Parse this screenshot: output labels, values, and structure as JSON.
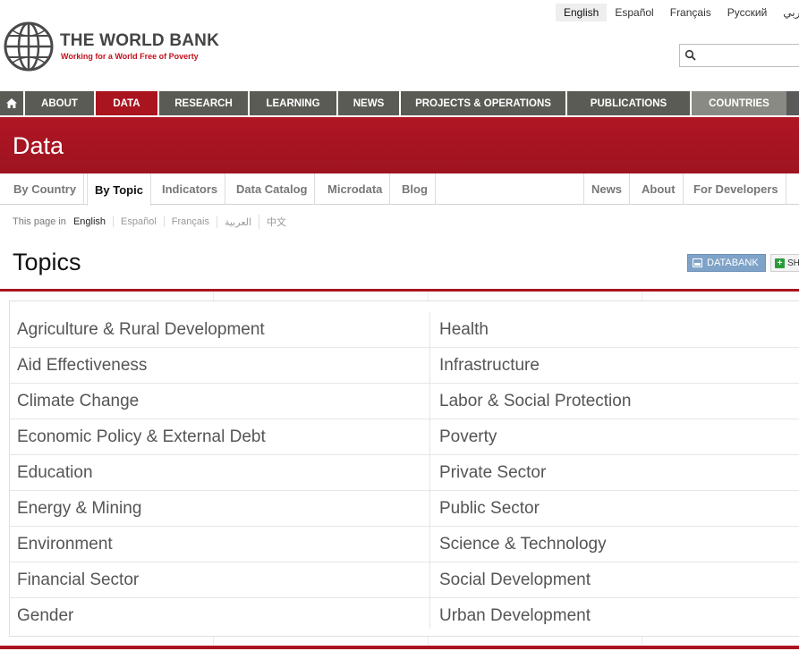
{
  "languages": {
    "items": [
      "English",
      "Español",
      "Français",
      "Русский",
      "عربي"
    ],
    "active": "English"
  },
  "logo": {
    "title": "THE WORLD BANK",
    "tagline": "Working for a World Free of Poverty"
  },
  "search": {
    "value": "",
    "placeholder": ""
  },
  "main_nav": {
    "home_icon": "home-icon",
    "items": [
      "ABOUT",
      "DATA",
      "RESEARCH",
      "LEARNING",
      "NEWS",
      "PROJECTS & OPERATIONS",
      "PUBLICATIONS",
      "COUNTRIES"
    ],
    "active": "DATA"
  },
  "banner": {
    "title": "Data"
  },
  "sub_nav": {
    "left": [
      "By Country",
      "By Topic",
      "Indicators",
      "Data Catalog",
      "Microdata",
      "Blog"
    ],
    "right": [
      "News",
      "About",
      "For Developers"
    ],
    "active": "By Topic"
  },
  "page_languages": {
    "label": "This page in",
    "items": [
      "English",
      "Español",
      "Français",
      "العربية",
      "中文"
    ],
    "current": "English"
  },
  "topics": {
    "title": "Topics",
    "databank_label": "DATABANK",
    "share_label": "SH",
    "left": [
      "Agriculture & Rural Development",
      "Aid Effectiveness",
      "Climate Change",
      "Economic Policy & External Debt",
      "Education",
      "Energy & Mining",
      "Environment",
      "Financial Sector",
      "Gender"
    ],
    "right": [
      "Health",
      "Infrastructure",
      "Labor & Social Protection",
      "Poverty",
      "Private Sector",
      "Public Sector",
      "Science & Technology",
      "Social Development",
      "Urban Development"
    ]
  },
  "colors": {
    "brand_red": "#a9141f",
    "nav_gray": "#5b5b55",
    "databank_blue": "#7fa3c8"
  }
}
